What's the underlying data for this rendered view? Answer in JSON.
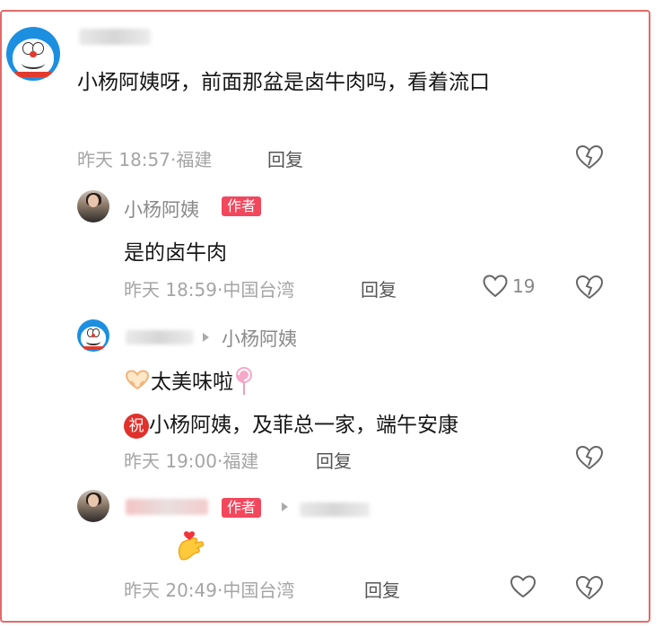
{
  "comments": [
    {
      "content": "小杨阿姨呀，前面那盆是卤牛肉吗，看着流口",
      "time": "昨天 18:57·",
      "location": "福建",
      "reply_label": "回复"
    },
    {
      "name": "小杨阿姨",
      "tag": "作者",
      "content": "是的卤牛肉",
      "time": "昨天 18:59·",
      "location": "中国台湾",
      "reply_label": "回复",
      "like_count": "19"
    },
    {
      "reply_to": "小杨阿姨",
      "content_line1": "太美味啦",
      "zhu_label": "祝",
      "content_line2": "小杨阿姨，及菲总一家，端午安康",
      "time": "昨天 19:00·",
      "location": "福建",
      "reply_label": "回复"
    },
    {
      "tag": "作者",
      "time": "昨天 20:49·",
      "location": "中国台湾",
      "reply_label": "回复"
    }
  ]
}
